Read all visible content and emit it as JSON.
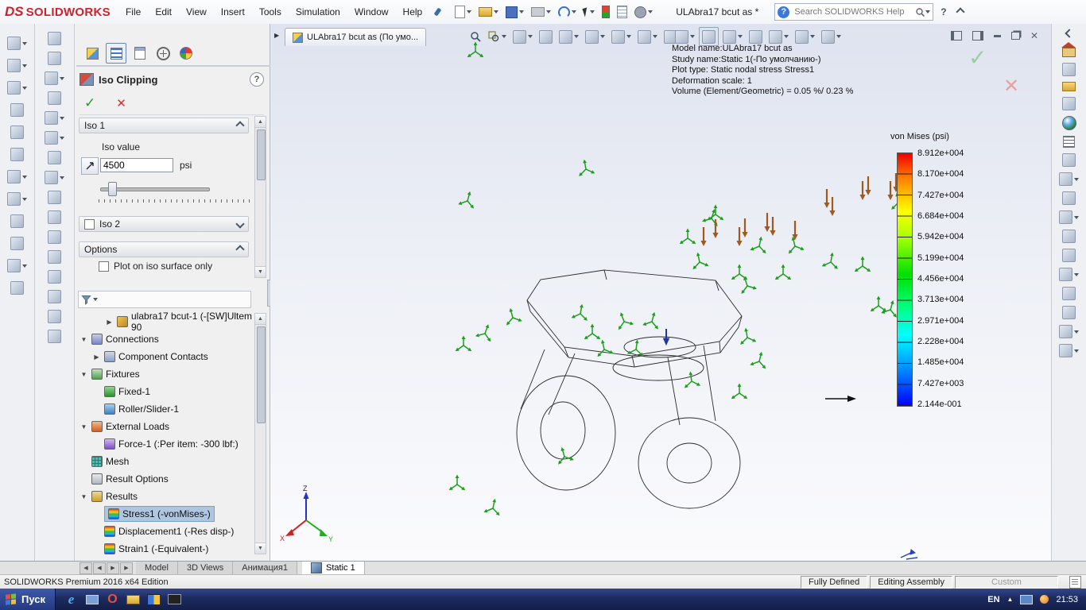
{
  "icons": {
    "check": "✓",
    "cross": "✕",
    "question": "?",
    "tree_expanded": "▼",
    "tree_collapsed": "▶",
    "flyout": "▶",
    "close": "✕",
    "nav_prev": "◀",
    "nav_next": "▶",
    "scroll_up": "▲",
    "scroll_down": "▼"
  },
  "menu_bar": {
    "logo_mark": "DS",
    "logo_text": "SOLIDWORKS",
    "menus": [
      "File",
      "Edit",
      "View",
      "Insert",
      "Tools",
      "Simulation",
      "Window",
      "Help"
    ],
    "document_title": "ULAbra17 bcut as *",
    "search_value": "Search SOLIDWORKS Help"
  },
  "property_manager": {
    "title": "Iso Clipping",
    "iso1_header": "Iso 1",
    "iso_value_label": "Iso value",
    "iso_value": "4500",
    "iso_unit": "psi",
    "iso2_header": "Iso 2",
    "options_header": "Options",
    "options_checkbox": "Plot on iso surface only"
  },
  "feature_tree": {
    "items": [
      {
        "label": "ulabra17 bcut-1 (-[SW]Ultem 90"
      },
      {
        "label": "Connections"
      },
      {
        "label": "Component Contacts"
      },
      {
        "label": "Fixtures"
      },
      {
        "label": "Fixed-1"
      },
      {
        "label": "Roller/Slider-1"
      },
      {
        "label": "External Loads"
      },
      {
        "label": "Force-1 (:Per item: -300 lbf:)"
      },
      {
        "label": "Mesh"
      },
      {
        "label": "Result Options"
      },
      {
        "label": "Results"
      },
      {
        "label": "Stress1 (-vonMises-)"
      },
      {
        "label": "Displacement1 (-Res disp-)"
      },
      {
        "label": "Strain1 (-Equivalent-)"
      }
    ]
  },
  "viewport": {
    "tab_label": "ULAbra17 bcut as  (По умо...",
    "info_lines": [
      "Model name:ULAbra17 bcut as",
      "Study name:Static 1(-По умолчанию-)",
      "Plot type: Static nodal stress Stress1",
      "Deformation scale: 1",
      "Volume (Element/Geometric) = 0.05 %/ 0.23 %"
    ],
    "triad": {
      "x": "X",
      "y": "Y",
      "z": "Z"
    }
  },
  "legend": {
    "title": "von Mises (psi)",
    "values": [
      "8.912e+004",
      "8.170e+004",
      "7.427e+004",
      "6.684e+004",
      "5.942e+004",
      "5.199e+004",
      "4.456e+004",
      "3.713e+004",
      "2.971e+004",
      "2.228e+004",
      "1.485e+004",
      "7.427e+003",
      "2.144e-001"
    ]
  },
  "bottom_tabs": {
    "items": [
      "Model",
      "3D Views",
      "Анимация1",
      "Static 1"
    ]
  },
  "status_bar": {
    "product": "SOLIDWORKS Premium 2016 x64 Edition",
    "defined": "Fully Defined",
    "mode": "Editing Assembly",
    "config": "Custom"
  },
  "taskbar": {
    "start": "Пуск",
    "language": "EN",
    "time": "21:53"
  }
}
